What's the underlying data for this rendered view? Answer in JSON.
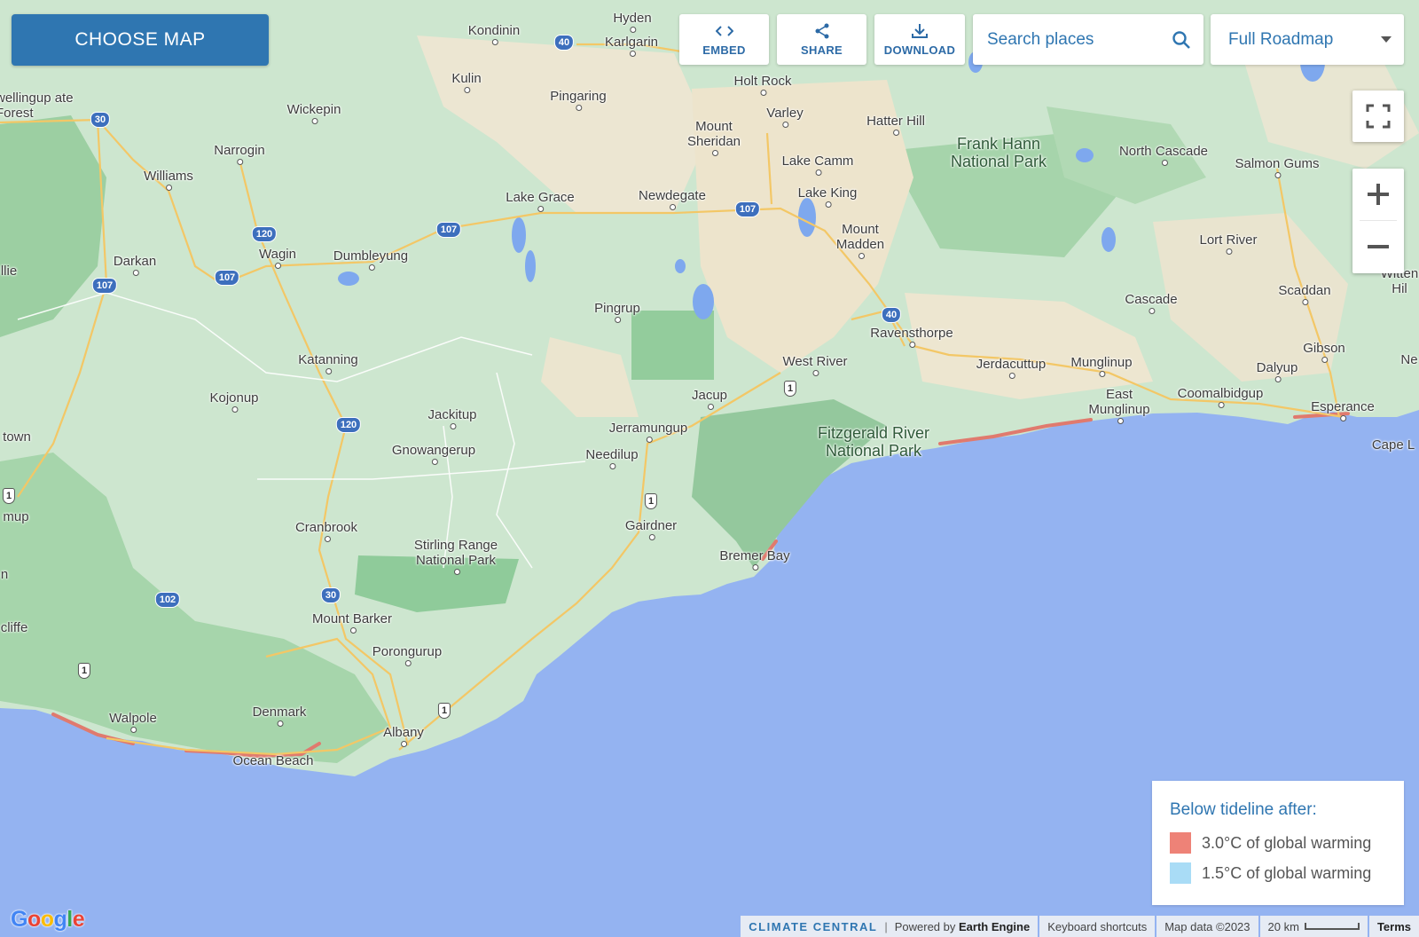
{
  "toolbar": {
    "choose_map": "CHOOSE MAP",
    "embed": "EMBED",
    "share": "SHARE",
    "download": "DOWNLOAD",
    "search_placeholder": "Search places",
    "map_type": "Full Roadmap"
  },
  "legend": {
    "title": "Below tideline after:",
    "items": [
      {
        "label": "3.0°C of global warming",
        "color": "#ee8277"
      },
      {
        "label": "1.5°C of global warming",
        "color": "#a9dcf6"
      }
    ]
  },
  "places": {
    "hyden": "Hyden",
    "kondinin": "Kondinin",
    "karlgarin": "Karlgarin",
    "kulin": "Kulin",
    "pingaring": "Pingaring",
    "holt_rock": "Holt Rock",
    "varley": "Varley",
    "mount_sheridan": "Mount Sheridan",
    "hatter_hill": "Hatter Hill",
    "lake_camm": "Lake Camm",
    "lake_king": "Lake King",
    "newdegate": "Newdegate",
    "lake_grace": "Lake Grace",
    "mount_madden": "Mount Madden",
    "frank_hann": "Frank Hann National Park",
    "north_cascade": "North Cascade",
    "salmon_gums": "Salmon Gums",
    "lort_river": "Lort River",
    "cascade": "Cascade",
    "scaddan": "Scaddan",
    "witten_hill": "Witten Hil",
    "wellingup": "wellingup ate Forest",
    "wickepin": "Wickepin",
    "narrogin": "Narrogin",
    "williams": "Williams",
    "darkan": "Darkan",
    "wagin": "Wagin",
    "dumbleyung": "Dumbleyung",
    "llie": "llie",
    "pingrup": "Pingrup",
    "ravensthorpe": "Ravensthorpe",
    "west_river": "West River",
    "jerdacuttup": "Jerdacuttup",
    "munglinup": "Munglinup",
    "east_munglinup": "East Munglinup",
    "coomalbidgup": "Coomalbidgup",
    "dalyup": "Dalyup",
    "gibson": "Gibson",
    "ne": "Ne",
    "esperance": "Esperance",
    "cape_le": "Cape L",
    "katanning": "Katanning",
    "kojonup": "Kojonup",
    "jacup": "Jacup",
    "jackitup": "Jackitup",
    "jerramungup": "Jerramungup",
    "gnowangerup": "Gnowangerup",
    "needilup": "Needilup",
    "fitzgerald": "Fitzgerald River National Park",
    "town": "town",
    "mup": "mup",
    "gairdner": "Gairdner",
    "cranbrook": "Cranbrook",
    "stirling": "Stirling Range National Park",
    "bremer_bay": "Bremer Bay",
    "n": "n",
    "mount_barker": "Mount Barker",
    "porongurup": "Porongurup",
    "cliffe": "cliffe",
    "walpole": "Walpole",
    "denmark": "Denmark",
    "albany": "Albany",
    "ocean_beach": "Ocean Beach"
  },
  "shields": [
    "40",
    "30",
    "120",
    "107",
    "107",
    "107",
    "107",
    "40",
    "120",
    "30",
    "102",
    "1",
    "1",
    "1",
    "1",
    "1",
    "1"
  ],
  "footer": {
    "brand": "CLIMATE CENTRAL",
    "powered_prefix": "Powered by",
    "powered_name": "Earth Engine",
    "shortcuts": "Keyboard shortcuts",
    "map_data": "Map data ©2023",
    "scale": "20 km",
    "terms": "Terms"
  },
  "google_logo": "Google"
}
